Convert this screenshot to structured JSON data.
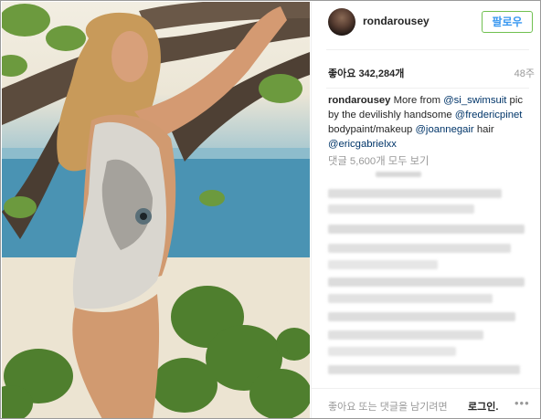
{
  "post": {
    "image_alt": "Photo of a woman in a tiger-print swimsuit leaning on tree branches at a beach",
    "header": {
      "username": "rondarousey",
      "follow_label": "팔로우"
    },
    "likes": {
      "label": "좋아요",
      "count": "342,284개"
    },
    "time_ago": "48주",
    "caption": {
      "username": "rondarousey",
      "text_1": " More from ",
      "mention_1": "@si_swimsuit",
      "text_2": " pic by the devilishly handsome ",
      "mention_2": "@fredericpinet",
      "text_3": " bodypaint/makeup ",
      "mention_3": "@joannegair",
      "text_4": " hair ",
      "mention_4": "@ericgabrielxx"
    },
    "view_comments_label": "댓글 5,600개 모두 보기",
    "footer": {
      "prompt_text": "좋아요 또는 댓글을 남기려면",
      "login_label": "로그인.",
      "more_icon": "ellipsis-icon"
    }
  },
  "colors": {
    "link": "#003569",
    "follow_text": "#3897f0",
    "follow_border": "#70c050",
    "muted": "#999999"
  }
}
